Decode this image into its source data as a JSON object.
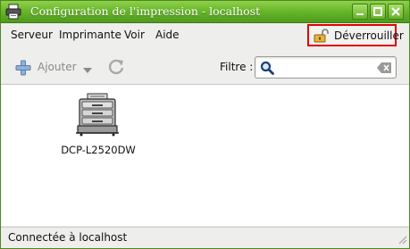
{
  "window": {
    "title": "Configuration de l'impression - localhost"
  },
  "menubar": {
    "items": [
      "Serveur",
      "Imprimante",
      "Voir",
      "Aide"
    ],
    "unlock_label": "Déverrouiller"
  },
  "toolbar": {
    "add_label": "Ajouter",
    "filter_label": "Filtre :",
    "search_value": ""
  },
  "printers": [
    {
      "name": "DCP-L2520DW",
      "icon": "printer-icon"
    }
  ],
  "statusbar": {
    "text": "Connectée à localhost"
  },
  "colors": {
    "titlebar": "#6ab82c",
    "highlight_border": "#e00000"
  }
}
